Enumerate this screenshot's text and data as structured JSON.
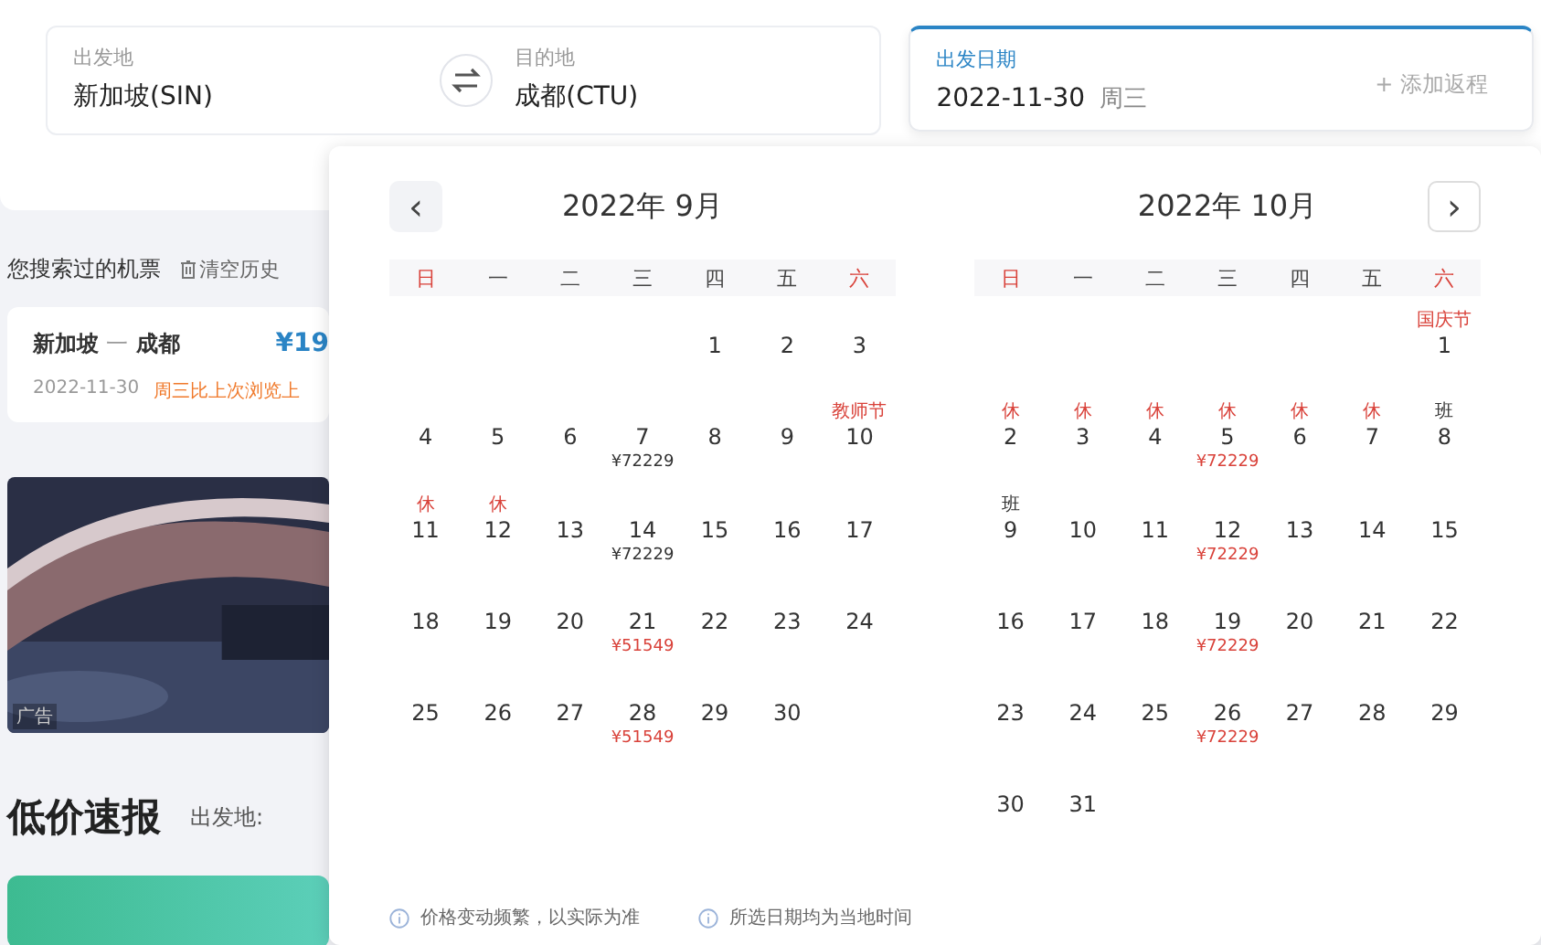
{
  "search": {
    "from": {
      "label": "出发地",
      "value": "新加坡(SIN)"
    },
    "to": {
      "label": "目的地",
      "value": "成都(CTU)"
    },
    "date": {
      "label": "出发日期",
      "value": "2022-11-30",
      "weekday": "周三",
      "selected": true
    },
    "add_return": "+ 添加返程"
  },
  "history": {
    "title": "您搜索过的机票",
    "clear": "清空历史",
    "items": [
      {
        "from": "新加坡",
        "sep": "一",
        "to": "成都",
        "price": "¥19",
        "date": "2022-11-30",
        "trend": "周三比上次浏览上"
      }
    ]
  },
  "ad": {
    "kind": "picture",
    "label": "广告"
  },
  "deals": {
    "title": "低价速报",
    "from_label": "出发地:"
  },
  "calendar": {
    "prev": "‹",
    "next": "›",
    "months": [
      {
        "title": "2022年 9月",
        "weekdays": [
          {
            "label": "日",
            "weekend": true
          },
          {
            "label": "一",
            "weekend": false
          },
          {
            "label": "二",
            "weekend": false
          },
          {
            "label": "三",
            "weekend": false
          },
          {
            "label": "四",
            "weekend": false
          },
          {
            "label": "五",
            "weekend": false
          },
          {
            "label": "六",
            "weekend": true
          }
        ],
        "weeks": [
          [
            {
              "kind": "blank"
            },
            {
              "kind": "blank"
            },
            {
              "kind": "blank"
            },
            {
              "kind": "blank"
            },
            {
              "kind": "day",
              "day": "1"
            },
            {
              "kind": "day",
              "day": "2"
            },
            {
              "kind": "day",
              "day": "3"
            }
          ],
          [
            {
              "kind": "day",
              "day": "4"
            },
            {
              "kind": "day",
              "day": "5"
            },
            {
              "kind": "day",
              "day": "6"
            },
            {
              "kind": "day",
              "day": "7",
              "price": "¥72229",
              "price_low": false
            },
            {
              "kind": "day",
              "day": "8"
            },
            {
              "kind": "day",
              "day": "9"
            },
            {
              "kind": "day",
              "day": "10",
              "note": "教师节",
              "holiday": true
            }
          ],
          [
            {
              "kind": "day",
              "day": "11",
              "note": "休",
              "holiday": true
            },
            {
              "kind": "day",
              "day": "12",
              "note": "休",
              "holiday": true
            },
            {
              "kind": "day",
              "day": "13"
            },
            {
              "kind": "day",
              "day": "14",
              "price": "¥72229",
              "price_low": false
            },
            {
              "kind": "day",
              "day": "15"
            },
            {
              "kind": "day",
              "day": "16"
            },
            {
              "kind": "day",
              "day": "17"
            }
          ],
          [
            {
              "kind": "day",
              "day": "18"
            },
            {
              "kind": "day",
              "day": "19"
            },
            {
              "kind": "day",
              "day": "20"
            },
            {
              "kind": "day",
              "day": "21",
              "price": "¥51549",
              "price_low": true
            },
            {
              "kind": "day",
              "day": "22"
            },
            {
              "kind": "day",
              "day": "23"
            },
            {
              "kind": "day",
              "day": "24"
            }
          ],
          [
            {
              "kind": "day",
              "day": "25"
            },
            {
              "kind": "day",
              "day": "26"
            },
            {
              "kind": "day",
              "day": "27"
            },
            {
              "kind": "day",
              "day": "28",
              "price": "¥51549",
              "price_low": true
            },
            {
              "kind": "day",
              "day": "29"
            },
            {
              "kind": "day",
              "day": "30"
            },
            {
              "kind": "blank"
            }
          ]
        ]
      },
      {
        "title": "2022年 10月",
        "weekdays": [
          {
            "label": "日",
            "weekend": true
          },
          {
            "label": "一",
            "weekend": false
          },
          {
            "label": "二",
            "weekend": false
          },
          {
            "label": "三",
            "weekend": false
          },
          {
            "label": "四",
            "weekend": false
          },
          {
            "label": "五",
            "weekend": false
          },
          {
            "label": "六",
            "weekend": true
          }
        ],
        "weeks": [
          [
            {
              "kind": "blank"
            },
            {
              "kind": "blank"
            },
            {
              "kind": "blank"
            },
            {
              "kind": "blank"
            },
            {
              "kind": "blank"
            },
            {
              "kind": "blank"
            },
            {
              "kind": "day",
              "day": "1",
              "note": "国庆节",
              "holiday": true
            }
          ],
          [
            {
              "kind": "day",
              "day": "2",
              "note": "休",
              "holiday": true
            },
            {
              "kind": "day",
              "day": "3",
              "note": "休",
              "holiday": true
            },
            {
              "kind": "day",
              "day": "4",
              "note": "休",
              "holiday": true
            },
            {
              "kind": "day",
              "day": "5",
              "note": "休",
              "holiday": true,
              "price": "¥72229",
              "price_low": true
            },
            {
              "kind": "day",
              "day": "6",
              "note": "休",
              "holiday": true
            },
            {
              "kind": "day",
              "day": "7",
              "note": "休",
              "holiday": true
            },
            {
              "kind": "day",
              "day": "8",
              "note": "班",
              "holiday": false
            }
          ],
          [
            {
              "kind": "day",
              "day": "9",
              "note": "班",
              "holiday": false
            },
            {
              "kind": "day",
              "day": "10"
            },
            {
              "kind": "day",
              "day": "11"
            },
            {
              "kind": "day",
              "day": "12",
              "price": "¥72229",
              "price_low": true
            },
            {
              "kind": "day",
              "day": "13"
            },
            {
              "kind": "day",
              "day": "14"
            },
            {
              "kind": "day",
              "day": "15"
            }
          ],
          [
            {
              "kind": "day",
              "day": "16"
            },
            {
              "kind": "day",
              "day": "17"
            },
            {
              "kind": "day",
              "day": "18"
            },
            {
              "kind": "day",
              "day": "19",
              "price": "¥72229",
              "price_low": true
            },
            {
              "kind": "day",
              "day": "20"
            },
            {
              "kind": "day",
              "day": "21"
            },
            {
              "kind": "day",
              "day": "22"
            }
          ],
          [
            {
              "kind": "day",
              "day": "23"
            },
            {
              "kind": "day",
              "day": "24"
            },
            {
              "kind": "day",
              "day": "25"
            },
            {
              "kind": "day",
              "day": "26",
              "price": "¥72229",
              "price_low": true
            },
            {
              "kind": "day",
              "day": "27"
            },
            {
              "kind": "day",
              "day": "28"
            },
            {
              "kind": "day",
              "day": "29"
            }
          ],
          [
            {
              "kind": "day",
              "day": "30"
            },
            {
              "kind": "day",
              "day": "31"
            },
            {
              "kind": "blank"
            },
            {
              "kind": "blank"
            },
            {
              "kind": "blank"
            },
            {
              "kind": "blank"
            },
            {
              "kind": "blank"
            }
          ]
        ]
      }
    ],
    "notes": [
      "价格变动频繁，以实际为准",
      "所选日期均为当地时间"
    ]
  }
}
